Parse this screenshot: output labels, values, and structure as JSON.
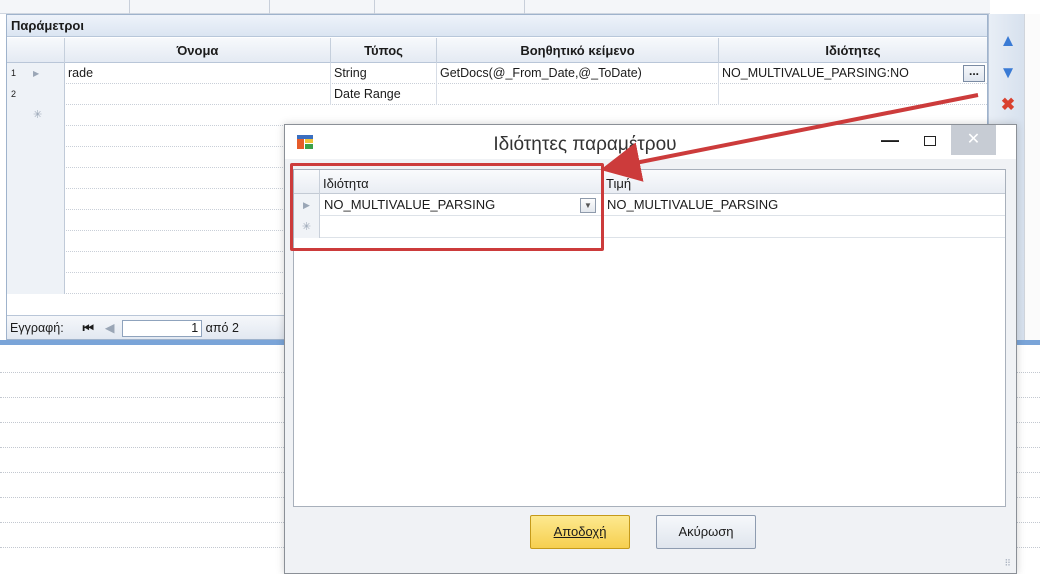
{
  "panel": {
    "title": "Παράμετροι",
    "columns": [
      "Όνομα",
      "Τύπος",
      "Βοηθητικό κείμενο",
      "Ιδιότητες"
    ],
    "rows": [
      {
        "num": "1",
        "name": "rade",
        "type": "String",
        "help": "GetDocs(@_From_Date,@_ToDate)",
        "props": "NO_MULTIVALUE_PARSING:NO"
      },
      {
        "num": "2",
        "name": "",
        "type": "Date Range",
        "help": "",
        "props": ""
      }
    ],
    "ellipsis": "...",
    "new_row_marker": "✳",
    "navbar": {
      "label": "Εγγραφή:",
      "first_glyph": "⏮",
      "prev_glyph": "◀",
      "position": "1",
      "of_label": "από",
      "total": "2"
    }
  },
  "sidebar": {
    "icons": [
      "move-up-icon",
      "move-down-icon",
      "delete-icon"
    ],
    "colors": {
      "arrows": "#3a7bd5",
      "delete": "#d9412f"
    }
  },
  "dialog": {
    "title": "Ιδιότητες παραμέτρου",
    "minimize_glyph": "—",
    "close_glyph": "✕",
    "columns": [
      "Ιδιότητα",
      "Τιμή"
    ],
    "rows": [
      {
        "property": "NO_MULTIVALUE_PARSING",
        "value": "NO_MULTIVALUE_PARSING"
      }
    ],
    "new_row_marker": "✳",
    "ok_label": "Αποδοχή",
    "cancel_label": "Ακύρωση",
    "accent": "#f6cf4f"
  },
  "annotation": {
    "color": "#cc3b3b"
  }
}
